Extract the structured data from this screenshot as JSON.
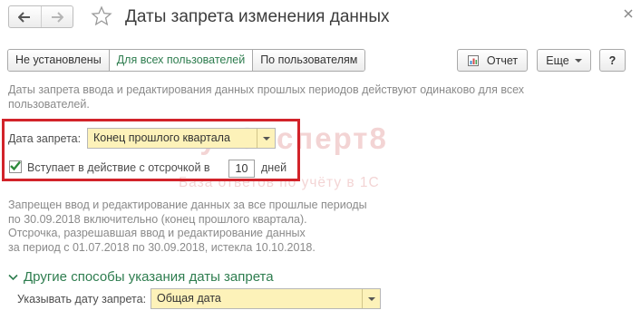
{
  "window": {
    "title": "Даты запрета изменения данных"
  },
  "icons": {
    "back": "arrow-left-icon",
    "forward": "arrow-right-icon",
    "favorite": "star-icon",
    "close": "close-icon",
    "report": "report-icon",
    "dropdown": "chevron-down-icon",
    "group": "chevron-down-icon",
    "check": "checkmark-icon"
  },
  "tabs": [
    {
      "label": "Не установлены",
      "active": false
    },
    {
      "label": "Для всех пользователей",
      "active": true
    },
    {
      "label": "По пользователям",
      "active": false
    }
  ],
  "toolbar": {
    "report_label": "Отчет",
    "more_label": "Еще",
    "help_label": "?"
  },
  "note": "Даты запрета ввода и редактирования данных прошлых периодов действуют одинаково для всех пользователей.",
  "form": {
    "date_label": "Дата запрета:",
    "date_value": "Конец прошлого квартала",
    "delay_checked": true,
    "delay_label": "Вступает в действие с отсрочкой в",
    "delay_days": "10",
    "delay_unit": "дней"
  },
  "info_lines": [
    "Запрещен ввод и редактирование данных за все прошлые периоды",
    "по 30.09.2018 включительно (конец прошлого квартала).",
    "Отсрочка, разрешавшая ввод и редактирование данных",
    "за период с 01.07.2018 по 30.09.2018, истекла 10.10.2018."
  ],
  "other": {
    "group_title": "Другие способы указания даты запрета",
    "spec_label": "Указывать дату запрета:",
    "spec_value": "Общая дата"
  },
  "watermark": {
    "main": "БухЭксперт8",
    "sub": "База ответов по учёту в 1С"
  },
  "colors": {
    "accent_green": "#2e7d4f",
    "highlight_red": "#d2232a",
    "field_yellow": "#fdf2b9"
  }
}
